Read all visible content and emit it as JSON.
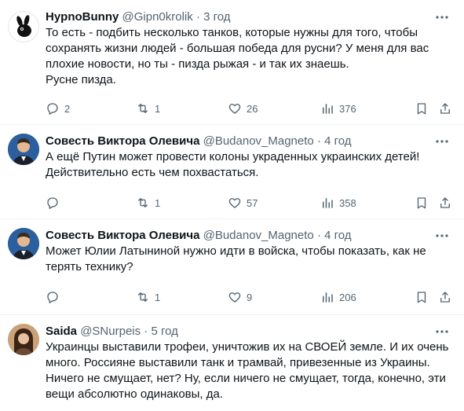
{
  "tweets": [
    {
      "name": "HypnoBunny",
      "handle": "@Gipn0krolik",
      "dot": "·",
      "time": "3 год",
      "text": "То есть - подбить несколько танков, которые нужны для того, чтобы\nсохранять жизни людей - большая победа для русни? У меня для вас\nплохие новости, но ты - пизда рыжая - и так их знаешь.\nРусне пизда.",
      "replies": "2",
      "retweets": "1",
      "likes": "26",
      "views": "376"
    },
    {
      "name": "Совесть Виктора Олевича",
      "handle": "@Budanov_Magneto",
      "dot": "·",
      "time": "4 год",
      "text": "А ещё Путин может провести колоны украденных украинских детей!\nДействительно есть чем похвастаться.",
      "replies": "",
      "retweets": "1",
      "likes": "57",
      "views": "358"
    },
    {
      "name": "Совесть Виктора Олевича",
      "handle": "@Budanov_Magneto",
      "dot": "·",
      "time": "4 год",
      "text": "Может Юлии Латыниной нужно идти в войска, чтобы показать, как не\nтерять технику?",
      "replies": "",
      "retweets": "1",
      "likes": "9",
      "views": "206"
    },
    {
      "name": "Saida",
      "handle": "@SNurpeis",
      "dot": "·",
      "time": "5 год",
      "text": "Украинцы выставили трофеи, уничтожив их на СВОЕЙ земле. И их очень\nмного. Россияне выставили танк и трамвай, привезенные из Украины.\nНичего не смущает, нет? Ну, если ничего не смущает, тогда, конечно, эти\nвещи абсолютно одинаковы, да.",
      "replies": "",
      "retweets": "",
      "likes": "",
      "views": ""
    }
  ],
  "icons": {
    "reply": "reply-icon",
    "retweet": "retweet-icon",
    "like": "heart-icon",
    "views": "views-icon",
    "bookmark": "bookmark-icon",
    "share": "share-icon",
    "more": "more-icon"
  },
  "colors": {
    "text": "#0f1419",
    "muted": "#536471",
    "divider": "#eff3f4"
  }
}
